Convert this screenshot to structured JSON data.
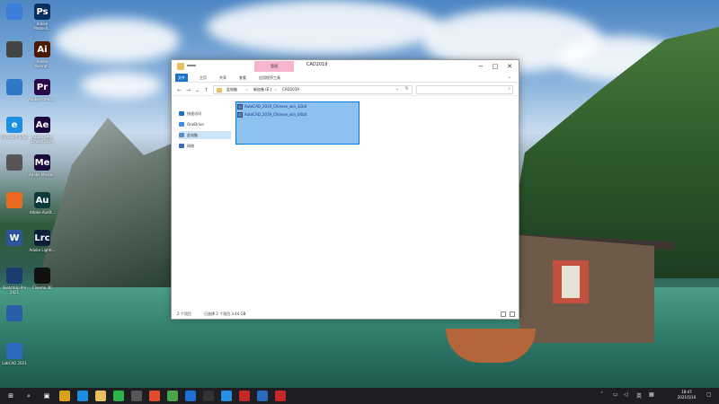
{
  "desktop": {
    "icons": [
      {
        "label": "",
        "glyph": "",
        "color": "#3c7fd6"
      },
      {
        "label": "",
        "glyph": "",
        "color": "#444"
      },
      {
        "label": "",
        "glyph": "",
        "color": "#2d78c8"
      },
      {
        "label": "Microsoft Edge",
        "glyph": "e",
        "color": "#1d8fe0"
      },
      {
        "label": "",
        "glyph": "",
        "color": "#555"
      },
      {
        "label": "",
        "glyph": "",
        "color": "#ea6a22"
      },
      {
        "label": "",
        "glyph": "W",
        "color": "#2b579a"
      },
      {
        "label": "SketchUp Pro 2021",
        "glyph": "",
        "color": "#1a3c6e"
      },
      {
        "label": "",
        "glyph": "",
        "color": "#2a5ea8"
      },
      {
        "label": "LabCAD 2021",
        "glyph": "",
        "color": "#2a6bbf"
      }
    ],
    "icons_col2": [
      {
        "label": "Adobe Photosh...",
        "glyph": "Ps",
        "color": "#0a2f5c"
      },
      {
        "label": "Adobe Illustrat...",
        "glyph": "Ai",
        "color": "#4a1a00"
      },
      {
        "label": "Adobe Premie...",
        "glyph": "Pr",
        "color": "#2a0a4a"
      },
      {
        "label": "Adobe After Effects 2021",
        "glyph": "Ae",
        "color": "#1a0a3a"
      },
      {
        "label": "Adobe Media...",
        "glyph": "Me",
        "color": "#1a0a3a"
      },
      {
        "label": "Adobe Audit...",
        "glyph": "Au",
        "color": "#0a3a3a"
      },
      {
        "label": "Adobe Lightr...",
        "glyph": "Lrc",
        "color": "#0a1e3a"
      },
      {
        "label": "Cinema 4D",
        "glyph": "",
        "color": "#111"
      }
    ]
  },
  "explorer": {
    "context_tab": "管理",
    "title": "CAD2019",
    "ribbon_tabs": [
      "文件",
      "主页",
      "共享",
      "查看",
      "应用程序工具"
    ],
    "address": {
      "crumbs": [
        "此电脑",
        "›",
        "新加卷 (E:)",
        "›",
        "CAD2019"
      ]
    },
    "nav_pane": [
      "快速访问",
      "OneDrive",
      "此电脑",
      "网络"
    ],
    "files": [
      "AutoCAD_2019_Chinese_win_32bit",
      "AutoCAD_2019_Chinese_win_64bit"
    ],
    "status": {
      "item_count": "2 个项目",
      "selected": "已选择 2 个项目  3.44 GB"
    }
  },
  "taskbar": {
    "apps": [
      {
        "glyph": "⊞",
        "color": "#1e1e22"
      },
      {
        "glyph": "⌕",
        "color": "#1e1e22"
      },
      {
        "glyph": "▣",
        "color": "#1e1e22"
      },
      {
        "glyph": "",
        "color": "#d9a21b"
      },
      {
        "glyph": "",
        "color": "#1d8fe0"
      },
      {
        "glyph": "",
        "color": "#e8c060"
      },
      {
        "glyph": "",
        "color": "#2db34a"
      },
      {
        "glyph": "",
        "color": "#555"
      },
      {
        "glyph": "",
        "color": "#e34b2e"
      },
      {
        "glyph": "",
        "color": "#4aa54a"
      },
      {
        "glyph": "",
        "color": "#1f6fd6"
      },
      {
        "glyph": "",
        "color": "#333"
      },
      {
        "glyph": "",
        "color": "#2a8fe0"
      },
      {
        "glyph": "",
        "color": "#c62828"
      },
      {
        "glyph": "",
        "color": "#2a6bbf"
      },
      {
        "glyph": "",
        "color": "#c62828"
      }
    ],
    "time": "18:47",
    "date": "2021/5/10"
  }
}
